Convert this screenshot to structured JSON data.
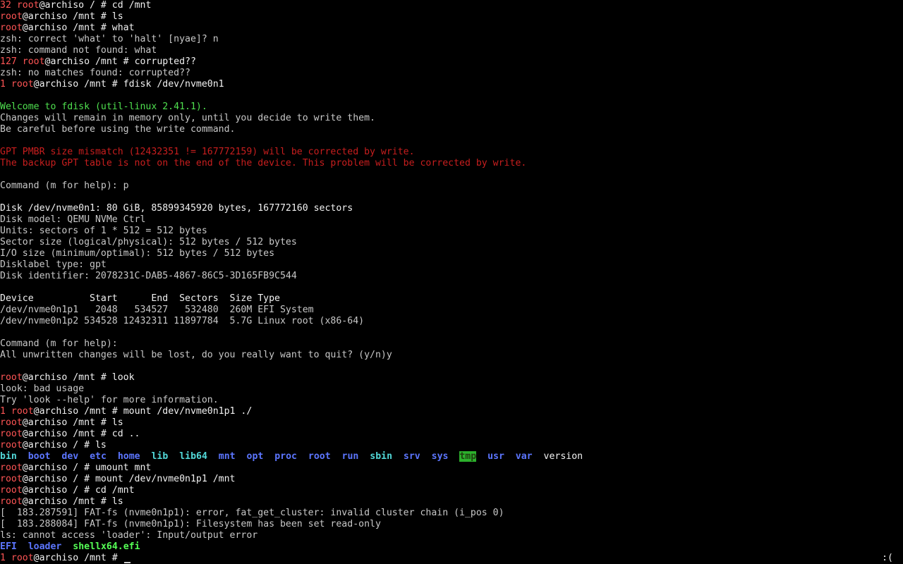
{
  "terminal": {
    "status_indicator": ":(",
    "lines": [
      [
        {
          "t": "32 ",
          "c": "red"
        },
        {
          "t": "root",
          "c": "red"
        },
        {
          "t": "@archiso / # cd /mnt",
          "c": "white"
        }
      ],
      [
        {
          "t": "root",
          "c": "red"
        },
        {
          "t": "@archiso /mnt # ls",
          "c": "white"
        }
      ],
      [
        {
          "t": "root",
          "c": "red"
        },
        {
          "t": "@archiso /mnt # what",
          "c": "white"
        }
      ],
      [
        {
          "t": "zsh: correct 'what' to 'halt' [nyae]? n",
          "c": "gray"
        }
      ],
      [
        {
          "t": "zsh: command not found: what",
          "c": "gray"
        }
      ],
      [
        {
          "t": "127 ",
          "c": "red"
        },
        {
          "t": "root",
          "c": "red"
        },
        {
          "t": "@archiso /mnt # corrupted??",
          "c": "white"
        }
      ],
      [
        {
          "t": "zsh: no matches found: corrupted??",
          "c": "gray"
        }
      ],
      [
        {
          "t": "1 ",
          "c": "red"
        },
        {
          "t": "root",
          "c": "red"
        },
        {
          "t": "@archiso /mnt # fdisk /dev/nvme0n1",
          "c": "white"
        }
      ],
      [],
      [
        {
          "t": "Welcome to fdisk (util-linux 2.41.1).",
          "c": "green"
        }
      ],
      [
        {
          "t": "Changes will remain in memory only, until you decide to write them.",
          "c": "gray"
        }
      ],
      [
        {
          "t": "Be careful before using the write command.",
          "c": "gray"
        }
      ],
      [],
      [
        {
          "t": "GPT PMBR size mismatch (12432351 != 167772159) will be corrected by write.",
          "c": "dred"
        }
      ],
      [
        {
          "t": "The backup GPT table is not on the end of the device. This problem will be corrected by write.",
          "c": "dred"
        }
      ],
      [],
      [
        {
          "t": "Command (m for help): p",
          "c": "gray"
        }
      ],
      [],
      [
        {
          "t": "Disk /dev/nvme0n1: 80 GiB, 85899345920 bytes, 167772160 sectors",
          "c": "white"
        }
      ],
      [
        {
          "t": "Disk model: QEMU NVMe Ctrl",
          "c": "gray"
        }
      ],
      [
        {
          "t": "Units: sectors of 1 * 512 = 512 bytes",
          "c": "gray"
        }
      ],
      [
        {
          "t": "Sector size (logical/physical): 512 bytes / 512 bytes",
          "c": "gray"
        }
      ],
      [
        {
          "t": "I/O size (minimum/optimal): 512 bytes / 512 bytes",
          "c": "gray"
        }
      ],
      [
        {
          "t": "Disklabel type: gpt",
          "c": "gray"
        }
      ],
      [
        {
          "t": "Disk identifier: 2078231C-DAB5-4867-86C5-3D165FB9C544",
          "c": "gray"
        }
      ],
      [],
      [
        {
          "t": "Device          Start      End  Sectors  Size Type",
          "c": "white"
        }
      ],
      [
        {
          "t": "/dev/nvme0n1p1   2048   534527   532480  260M EFI System",
          "c": "gray"
        }
      ],
      [
        {
          "t": "/dev/nvme0n1p2 534528 12432311 11897784  5.7G Linux root (x86-64)",
          "c": "gray"
        }
      ],
      [],
      [
        {
          "t": "Command (m for help):",
          "c": "gray"
        }
      ],
      [
        {
          "t": "All unwritten changes will be lost, do you really want to quit? (y/n)y",
          "c": "gray"
        }
      ],
      [],
      [
        {
          "t": "root",
          "c": "red"
        },
        {
          "t": "@archiso /mnt # look",
          "c": "white"
        }
      ],
      [
        {
          "t": "look: bad usage",
          "c": "gray"
        }
      ],
      [
        {
          "t": "Try 'look --help' for more information.",
          "c": "gray"
        }
      ],
      [
        {
          "t": "1 ",
          "c": "red"
        },
        {
          "t": "root",
          "c": "red"
        },
        {
          "t": "@archiso /mnt # mount /dev/nvme0n1p1 ./",
          "c": "white"
        }
      ],
      [
        {
          "t": "root",
          "c": "red"
        },
        {
          "t": "@archiso /mnt # ls",
          "c": "white"
        }
      ],
      [
        {
          "t": "root",
          "c": "red"
        },
        {
          "t": "@archiso /mnt # cd ..",
          "c": "white"
        }
      ],
      [
        {
          "t": "root",
          "c": "red"
        },
        {
          "t": "@archiso / # ls",
          "c": "white"
        }
      ],
      [
        {
          "t": "bin",
          "c": "cyan"
        },
        {
          "t": "  ",
          "c": "gray"
        },
        {
          "t": "boot",
          "c": "blue"
        },
        {
          "t": "  ",
          "c": "gray"
        },
        {
          "t": "dev",
          "c": "blue"
        },
        {
          "t": "  ",
          "c": "gray"
        },
        {
          "t": "etc",
          "c": "blue"
        },
        {
          "t": "  ",
          "c": "gray"
        },
        {
          "t": "home",
          "c": "blue"
        },
        {
          "t": "  ",
          "c": "gray"
        },
        {
          "t": "lib",
          "c": "cyan"
        },
        {
          "t": "  ",
          "c": "gray"
        },
        {
          "t": "lib64",
          "c": "cyan"
        },
        {
          "t": "  ",
          "c": "gray"
        },
        {
          "t": "mnt",
          "c": "blue"
        },
        {
          "t": "  ",
          "c": "gray"
        },
        {
          "t": "opt",
          "c": "blue"
        },
        {
          "t": "  ",
          "c": "gray"
        },
        {
          "t": "proc",
          "c": "blue"
        },
        {
          "t": "  ",
          "c": "gray"
        },
        {
          "t": "root",
          "c": "blue"
        },
        {
          "t": "  ",
          "c": "gray"
        },
        {
          "t": "run",
          "c": "blue"
        },
        {
          "t": "  ",
          "c": "gray"
        },
        {
          "t": "sbin",
          "c": "cyan"
        },
        {
          "t": "  ",
          "c": "gray"
        },
        {
          "t": "srv",
          "c": "blue"
        },
        {
          "t": "  ",
          "c": "gray"
        },
        {
          "t": "sys",
          "c": "blue"
        },
        {
          "t": "  ",
          "c": "gray"
        },
        {
          "t": "tmp",
          "c": "tmp"
        },
        {
          "t": "  ",
          "c": "gray"
        },
        {
          "t": "usr",
          "c": "blue"
        },
        {
          "t": "  ",
          "c": "gray"
        },
        {
          "t": "var",
          "c": "blue"
        },
        {
          "t": "  ",
          "c": "gray"
        },
        {
          "t": "version",
          "c": "white"
        }
      ],
      [
        {
          "t": "root",
          "c": "red"
        },
        {
          "t": "@archiso / # umount mnt",
          "c": "white"
        }
      ],
      [
        {
          "t": "root",
          "c": "red"
        },
        {
          "t": "@archiso / # mount /dev/nvme0n1p1 /mnt",
          "c": "white"
        }
      ],
      [
        {
          "t": "root",
          "c": "red"
        },
        {
          "t": "@archiso / # cd /mnt",
          "c": "white"
        }
      ],
      [
        {
          "t": "root",
          "c": "red"
        },
        {
          "t": "@archiso /mnt # ls",
          "c": "white"
        }
      ],
      [
        {
          "t": "[  183.287591] FAT-fs (nvme0n1p1): error, fat_get_cluster: invalid cluster chain (i_pos 0)",
          "c": "gray"
        }
      ],
      [
        {
          "t": "[  183.288084] FAT-fs (nvme0n1p1): Filesystem has been set read-only",
          "c": "gray"
        }
      ],
      [
        {
          "t": "ls: cannot access 'loader': Input/output error",
          "c": "gray"
        }
      ],
      [
        {
          "t": "EFI",
          "c": "blue"
        },
        {
          "t": "  ",
          "c": "gray"
        },
        {
          "t": "loader",
          "c": "blue"
        },
        {
          "t": "  ",
          "c": "gray"
        },
        {
          "t": "shellx64.efi",
          "c": "bgreen"
        }
      ],
      [
        {
          "t": "1 ",
          "c": "red"
        },
        {
          "t": "root",
          "c": "red"
        },
        {
          "t": "@archiso /mnt # ",
          "c": "white"
        }
      ]
    ]
  }
}
